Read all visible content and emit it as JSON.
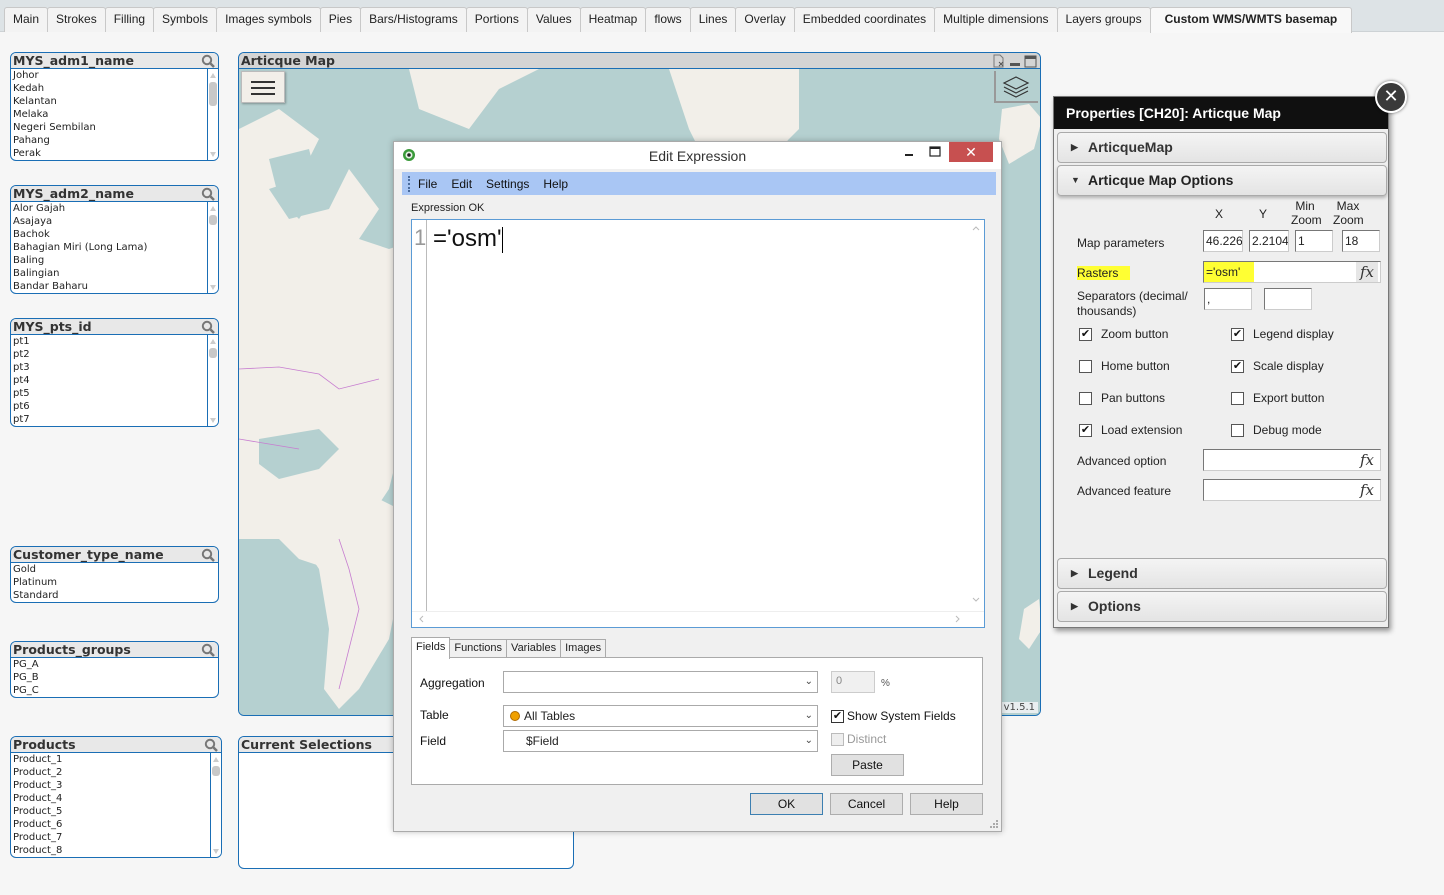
{
  "tabs": [
    {
      "label": "Main"
    },
    {
      "label": "Strokes"
    },
    {
      "label": "Filling"
    },
    {
      "label": "Symbols"
    },
    {
      "label": "Images symbols"
    },
    {
      "label": "Pies"
    },
    {
      "label": "Bars/Histograms"
    },
    {
      "label": "Portions"
    },
    {
      "label": "Values"
    },
    {
      "label": "Heatmap"
    },
    {
      "label": "flows"
    },
    {
      "label": "Lines"
    },
    {
      "label": "Overlay"
    },
    {
      "label": "Embedded coordinates"
    },
    {
      "label": "Multiple dimensions"
    },
    {
      "label": "Layers groups"
    },
    {
      "label": "Custom WMS/WMTS basemap"
    }
  ],
  "active_tab": "Custom WMS/WMTS basemap",
  "listboxes": {
    "adm1": {
      "title": "MYS_adm1_name",
      "items": [
        "Johor",
        "Kedah",
        "Kelantan",
        "Melaka",
        "Negeri Sembilan",
        "Pahang",
        "Perak"
      ]
    },
    "adm2": {
      "title": "MYS_adm2_name",
      "items": [
        "Alor Gajah",
        "Asajaya",
        "Bachok",
        "Bahagian Miri (Long Lama)",
        "Baling",
        "Balingian",
        "Bandar Baharu"
      ]
    },
    "pts": {
      "title": "MYS_pts_id",
      "items": [
        "pt1",
        "pt2",
        "pt3",
        "pt4",
        "pt5",
        "pt6",
        "pt7"
      ]
    },
    "customer": {
      "title": "Customer_type_name",
      "items": [
        "Gold",
        "Platinum",
        "Standard"
      ]
    },
    "pgroups": {
      "title": "Products_groups",
      "items": [
        "PG_A",
        "PG_B",
        "PG_C"
      ]
    },
    "products": {
      "title": "Products",
      "items": [
        "Product_1",
        "Product_2",
        "Product_3",
        "Product_4",
        "Product_5",
        "Product_6",
        "Product_7",
        "Product_8"
      ]
    }
  },
  "map": {
    "title": "Articque Map",
    "version": "v1.5.1"
  },
  "current_selections": {
    "title": "Current Selections"
  },
  "dialog": {
    "title": "Edit Expression",
    "close_glyph": "✕",
    "menu": [
      "File",
      "Edit",
      "Settings",
      "Help"
    ],
    "status": "Expression OK",
    "line_number": "1",
    "expression": "='osm'",
    "bottom_tabs": [
      "Fields",
      "Functions",
      "Variables",
      "Images"
    ],
    "active_bottom_tab": "Fields",
    "aggregation_label": "Aggregation",
    "aggregation_value": "",
    "percent_value": "0",
    "percent_sign": "%",
    "table_label": "Table",
    "table_value": "All Tables",
    "field_label": "Field",
    "field_value": "$Field",
    "show_system_fields": {
      "label": "Show System Fields",
      "checked": true
    },
    "distinct": {
      "label": "Distinct",
      "checked": false,
      "disabled": true
    },
    "paste_label": "Paste",
    "ok_label": "OK",
    "cancel_label": "Cancel",
    "help_label": "Help",
    "table_dot_color": "#f0a000"
  },
  "properties": {
    "title": "Properties [CH20]: Articque Map",
    "close_glyph": "✕",
    "sections": {
      "articquemap": "ArticqueMap",
      "options_open": "Articque Map Options",
      "legend": "Legend",
      "options": "Options"
    },
    "col_x": "X",
    "col_y": "Y",
    "col_minzoom": "Min Zoom",
    "col_maxzoom": "Max Zoom",
    "map_parameters_label": "Map parameters",
    "x_value": "46.226",
    "y_value": "2.2104",
    "minzoom_value": "1",
    "maxzoom_value": "18",
    "rasters_label": "Rasters",
    "rasters_value": "='osm'",
    "separators_label": "Separators (decimal/ thousands)",
    "decimal_sep": ",",
    "thousands_sep": "",
    "checkboxes": [
      {
        "label": "Zoom button",
        "checked": true
      },
      {
        "label": "Legend display",
        "checked": true
      },
      {
        "label": "Home button",
        "checked": false
      },
      {
        "label": "Scale display",
        "checked": true
      },
      {
        "label": "Pan buttons",
        "checked": false
      },
      {
        "label": "Export button",
        "checked": false
      },
      {
        "label": "Load extension",
        "checked": true
      },
      {
        "label": "Debug mode",
        "checked": false
      }
    ],
    "advanced_option_label": "Advanced option",
    "advanced_option_value": "",
    "advanced_feature_label": "Advanced feature",
    "advanced_feature_value": "",
    "fx_glyph": "fx",
    "highlight_color": "#ffff33"
  },
  "colors": {
    "object_border": "#1a6eb5",
    "map_water": "#b5d0d0",
    "map_land": "#f2efe9",
    "map_border": "#c77dd0"
  }
}
